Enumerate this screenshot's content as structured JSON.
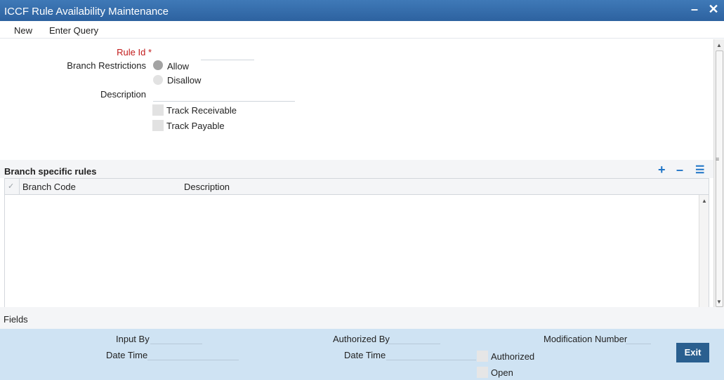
{
  "window": {
    "title": "ICCF Rule Availability Maintenance",
    "minimize_glyph": "–",
    "close_glyph": "✕"
  },
  "menu": {
    "new_label": "New",
    "enter_query_label": "Enter Query"
  },
  "form": {
    "rule_id_label": "Rule Id",
    "rule_id_required_mark": "*",
    "rule_id_value": "",
    "branch_restrictions_label": "Branch Restrictions",
    "allow_label": "Allow",
    "disallow_label": "Disallow",
    "selected_restriction": "Allow",
    "description_label": "Description",
    "description_value": "",
    "track_receivable_label": "Track Receivable",
    "track_receivable_checked": false,
    "track_payable_label": "Track Payable",
    "track_payable_checked": false
  },
  "branch_rules": {
    "title": "Branch specific rules",
    "add_icon": "+",
    "remove_icon": "–",
    "list_icon": "☰",
    "check_glyph": "✓",
    "columns": [
      "Branch Code",
      "Description"
    ],
    "rows": []
  },
  "fields_bar": {
    "label": "Fields"
  },
  "footer": {
    "input_by_label": "Input By",
    "date_time_label_1": "Date Time",
    "authorized_by_label": "Authorized By",
    "date_time_label_2": "Date Time",
    "authorized_label": "Authorized",
    "open_label": "Open",
    "modification_number_label": "Modification Number",
    "exit_label": "Exit"
  },
  "colors": {
    "title_bar": "#2d62a0",
    "footer_bg": "#cfe3f3",
    "exit_button": "#2a5f8f",
    "required": "#c11a1a",
    "tool_icons": "#1d73c6"
  }
}
